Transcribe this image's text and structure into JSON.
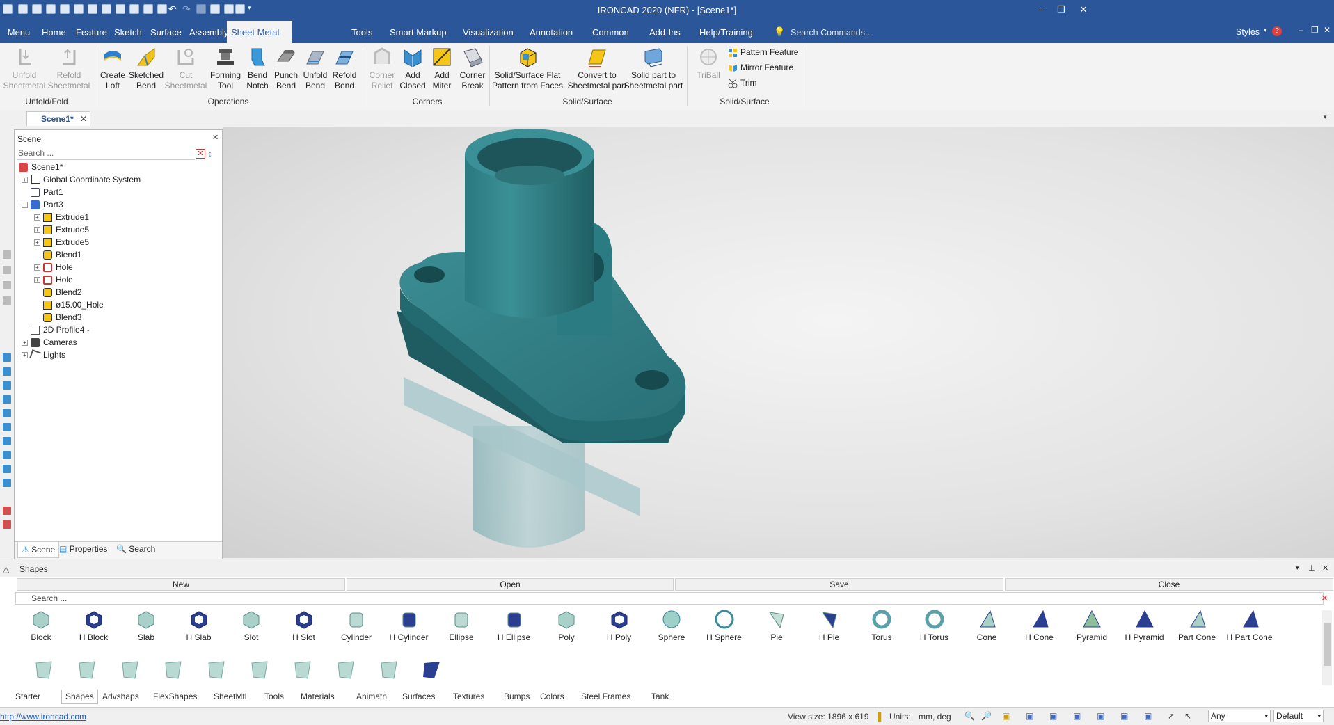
{
  "window": {
    "title": "IRONCAD 2020 (NFR) - [Scene1*]"
  },
  "menu_bar": {
    "tabs": [
      "Menu",
      "Home",
      "Feature",
      "Sketch",
      "Surface",
      "Assembly",
      "Sheet Metal",
      "Tools",
      "Smart Markup",
      "Visualization",
      "Annotation",
      "Common",
      "Add-Ins",
      "Help/Training"
    ],
    "active_tab": "Sheet Metal",
    "search_placeholder": "Search Commands...",
    "styles_label": "Styles"
  },
  "ribbon": {
    "unfold": {
      "line1": "Unfold",
      "line2": "Sheetmetal"
    },
    "refold": {
      "line1": "Refold",
      "line2": "Sheetmetal"
    },
    "group_unfold": "Unfold/Fold",
    "create_loft": {
      "line1": "Create",
      "line2": "Loft"
    },
    "sketched_bend": {
      "line1": "Sketched",
      "line2": "Bend"
    },
    "cut_sheetmetal": {
      "line1": "Cut",
      "line2": "Sheetmetal"
    },
    "forming_tool": {
      "line1": "Forming",
      "line2": "Tool"
    },
    "bend_notch": {
      "line1": "Bend",
      "line2": "Notch"
    },
    "punch_bend": {
      "line1": "Punch",
      "line2": "Bend"
    },
    "unfold_bend": {
      "line1": "Unfold",
      "line2": "Bend"
    },
    "refold_bend": {
      "line1": "Refold",
      "line2": "Bend"
    },
    "group_operations": "Operations",
    "corner_relief": {
      "line1": "Corner",
      "line2": "Relief"
    },
    "add_closed": {
      "line1": "Add",
      "line2": "Closed"
    },
    "add_miter": {
      "line1": "Add",
      "line2": "Miter"
    },
    "corner_break": {
      "line1": "Corner",
      "line2": "Break"
    },
    "group_corners": "Corners",
    "flat_pattern": {
      "line1": "Solid/Surface Flat",
      "line2": "Pattern from Faces"
    },
    "convert_sheetmetal": {
      "line1": "Convert to",
      "line2": "Sheetmetal part"
    },
    "solid_to_sheetmetal": {
      "line1": "Solid part to",
      "line2": "Sheetmetal part"
    },
    "group_solid_surface_1": "Solid/Surface",
    "triball": "TriBall",
    "pattern_feature": "Pattern Feature",
    "mirror_feature": "Mirror Feature",
    "trim": "Trim",
    "group_solid_surface_2": "Solid/Surface"
  },
  "document_tab": "Scene1*",
  "scene_panel": {
    "title": "Scene",
    "search_placeholder": "Search ...",
    "tree": [
      {
        "label": "Scene1*"
      },
      {
        "label": "Global Coordinate System"
      },
      {
        "label": "Part1"
      },
      {
        "label": "Part3"
      },
      {
        "label": "Extrude1"
      },
      {
        "label": "Extrude5"
      },
      {
        "label": "Extrude5"
      },
      {
        "label": "Blend1"
      },
      {
        "label": "Hole"
      },
      {
        "label": "Hole"
      },
      {
        "label": "Blend2"
      },
      {
        "label": "ø15.00_Hole"
      },
      {
        "label": "Blend3"
      },
      {
        "label": "2D Profile4 -"
      },
      {
        "label": "Cameras"
      },
      {
        "label": "Lights"
      }
    ],
    "tabs": [
      "Scene",
      "Properties",
      "Search"
    ]
  },
  "shapes_panel": {
    "title": "Shapes",
    "buttons": [
      "New",
      "Open",
      "Save",
      "Close"
    ],
    "search_placeholder": "Search ...",
    "items": [
      "Block",
      "H Block",
      "Slab",
      "H Slab",
      "Slot",
      "H Slot",
      "Cylinder",
      "H Cylinder",
      "Ellipse",
      "H Ellipse",
      "Poly",
      "H Poly",
      "Sphere",
      "H Sphere",
      "Pie",
      "H Pie",
      "Torus",
      "H Torus",
      "Cone",
      "H Cone",
      "Pyramid",
      "H Pyramid",
      "Part Cone",
      "H Part Cone"
    ],
    "library_tabs": [
      "Starter",
      "Shapes",
      "Advshaps",
      "FlexShapes",
      "SheetMtl",
      "Tools",
      "Materials",
      "Animatn",
      "Surfaces",
      "Textures",
      "Bumps",
      "Colors",
      "Steel Frames",
      "Tank"
    ],
    "active_library_tab": "Shapes",
    "part_color": "#2a7a80"
  },
  "status_bar": {
    "url": "http://www.ironcad.com",
    "view_size": "View size: 1896 x  619",
    "units_label": "Units:",
    "units_value": "mm, deg",
    "filter_value": "Any",
    "style_value": "Default"
  }
}
